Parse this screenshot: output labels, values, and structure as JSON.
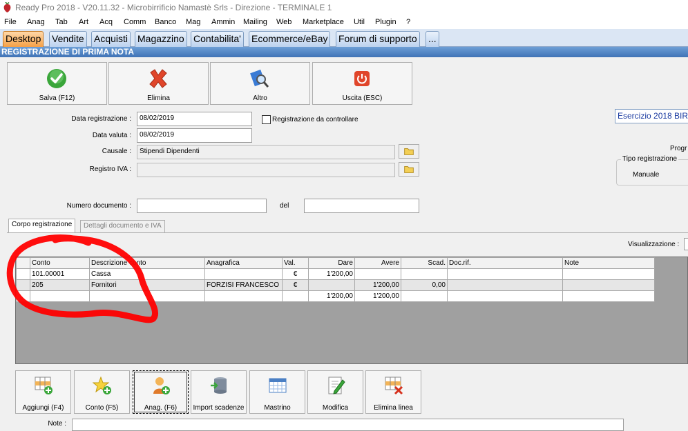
{
  "window": {
    "title": "Ready Pro 2018 - V20.11.32 - Microbirrificio Namastè Srls - Direzione - TERMINALE 1"
  },
  "menu": [
    "File",
    "Anag",
    "Tab",
    "Art",
    "Acq",
    "Comm",
    "Banco",
    "Mag",
    "Ammin",
    "Mailing",
    "Web",
    "Marketplace",
    "Util",
    "Plugin",
    "?"
  ],
  "tabs": [
    "Desktop",
    "Vendite",
    "Acquisti",
    "Magazzino",
    "Contabilita'",
    "Ecommerce/eBay",
    "Forum di supporto",
    "..."
  ],
  "section": {
    "title": "REGISTRAZIONE DI PRIMA NOTA"
  },
  "toolbar": {
    "save": "Salva (F12)",
    "delete": "Elimina",
    "other": "Altro",
    "exit": "Uscita (ESC)"
  },
  "form": {
    "data_registrazione_label": "Data registrazione :",
    "data_registrazione": "08/02/2019",
    "registrazione_controllare_label": "Registrazione da controllare",
    "data_valuta_label": "Data valuta :",
    "data_valuta": "08/02/2019",
    "causale_label": "Causale :",
    "causale": "Stipendi Dipendenti",
    "registro_iva_label": "Registro IVA :",
    "registro_iva": "",
    "numero_documento_label": "Numero documento :",
    "numero_documento": "",
    "del_label": "del",
    "del_value": ""
  },
  "right_panel": {
    "esercizio": "Esercizio 2018 BIR",
    "progr_label": "Progr",
    "tipo_registrazione_label": "Tipo registrazione",
    "tipo_registrazione": "Manuale",
    "visualizzazione_label": "Visualizzazione :"
  },
  "inner_tabs": [
    "Corpo registrazione",
    "Dettagli documento e IVA"
  ],
  "grid": {
    "columns": [
      "Conto",
      "Descrizione conto",
      "Anagrafica",
      "Val.",
      "Dare",
      "Avere",
      "Scad.",
      "Doc.rif.",
      "Note"
    ],
    "rows": [
      [
        "101.00001",
        "Cassa",
        "",
        "€",
        "1'200,00",
        "",
        "",
        "",
        ""
      ],
      [
        "205",
        "Fornitori",
        "FORZISI FRANCESCO",
        "€",
        "",
        "1'200,00",
        "0,00",
        "",
        ""
      ]
    ],
    "totals": {
      "dare": "1'200,00",
      "avere": "1'200,00"
    }
  },
  "bottom_buttons": [
    "Aggiungi (F4)",
    "Conto (F5)",
    "Anag. (F6)",
    "Import scadenze",
    "Mastrino",
    "Modifica",
    "Elimina linea"
  ],
  "note_label": "Note :",
  "note_value": "",
  "colors": {
    "active_tab": "#f5a047",
    "section_header": "#3f73b6",
    "annotation": "#ff0000"
  }
}
